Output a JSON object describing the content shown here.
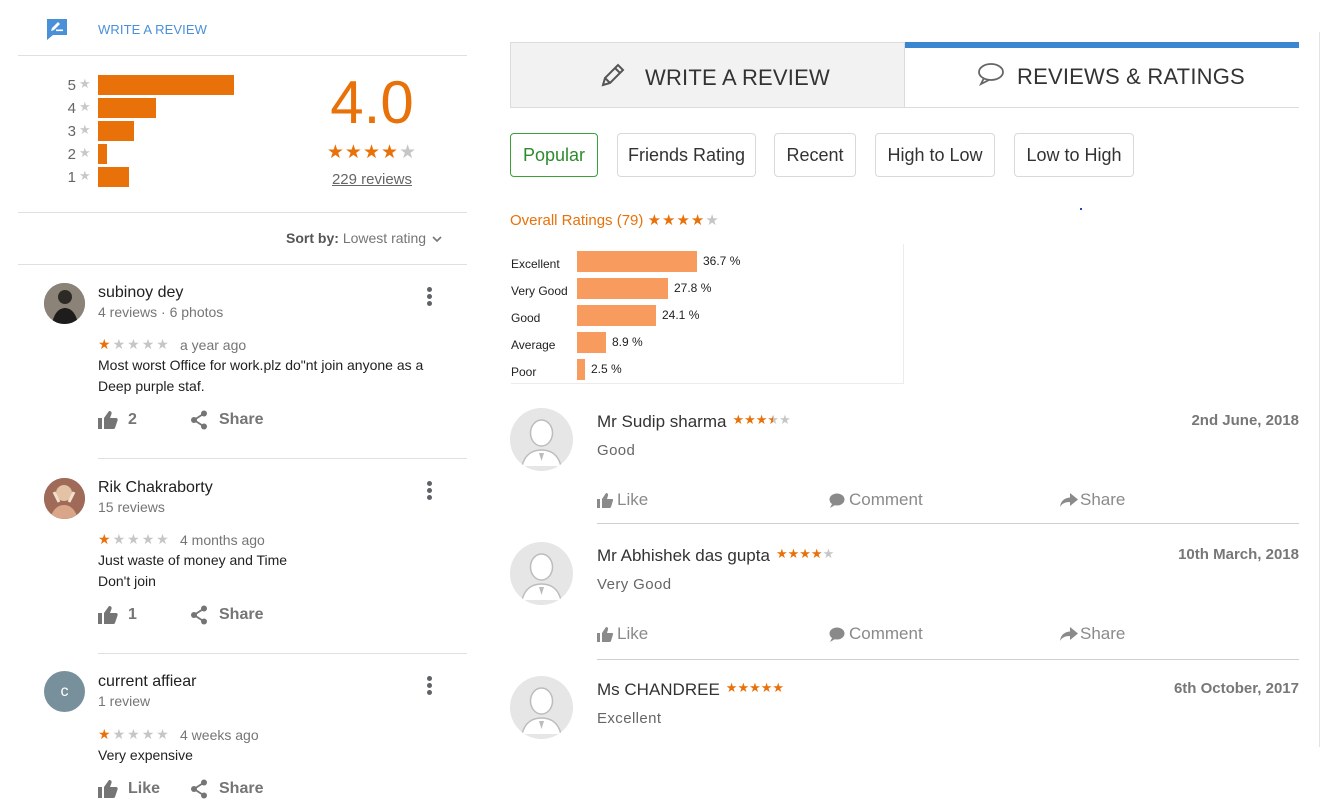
{
  "left": {
    "write_review": "WRITE A REVIEW",
    "histogram": [
      {
        "stars": "5",
        "fraction": 0.61
      },
      {
        "stars": "4",
        "fraction": 0.26
      },
      {
        "stars": "3",
        "fraction": 0.16
      },
      {
        "stars": "2",
        "fraction": 0.04
      },
      {
        "stars": "1",
        "fraction": 0.14
      }
    ],
    "score": "4.0",
    "score_stars": 4,
    "reviews_count": "229 reviews",
    "sort_label": "Sort by:",
    "sort_value": "Lowest rating",
    "reviews": [
      {
        "name": "subinoy dey",
        "meta": "4 reviews · 6 photos",
        "rating": 1,
        "time": "a year ago",
        "text": "Most worst Office for work.plz do\"nt join anyone as  a Deep purple staf.",
        "likes": "2",
        "share": "Share"
      },
      {
        "name": "Rik Chakraborty",
        "meta": "15 reviews",
        "rating": 1,
        "time": "4 months ago",
        "text": "Just waste of money and Time\nDon't join",
        "likes": "1",
        "share": "Share"
      },
      {
        "name": "current affiear",
        "meta": "1 review",
        "rating": 1,
        "time": "4 weeks ago",
        "text": "Very expensive",
        "likes": "Like",
        "share": "Share",
        "initial": "c"
      }
    ]
  },
  "right": {
    "tabs": {
      "write": "WRITE A REVIEW",
      "reviews": "REVIEWS & RATINGS"
    },
    "filters": [
      "Popular",
      "Friends Rating",
      "Recent",
      "High to Low",
      "Low to High"
    ],
    "overall_label": "Overall Ratings (79)",
    "overall_stars": 4,
    "distribution": [
      {
        "label": "Excellent",
        "pct": 36.7,
        "pct_text": "36.7 %"
      },
      {
        "label": "Very Good",
        "pct": 27.8,
        "pct_text": "27.8 %"
      },
      {
        "label": "Good",
        "pct": 24.1,
        "pct_text": "24.1 %"
      },
      {
        "label": "Average",
        "pct": 8.9,
        "pct_text": "8.9 %"
      },
      {
        "label": "Poor",
        "pct": 2.5,
        "pct_text": "2.5 %"
      }
    ],
    "reviews": [
      {
        "name": "Mr Sudip sharma",
        "rating": 3.5,
        "date": "2nd June, 2018",
        "text": "Good"
      },
      {
        "name": "Mr Abhishek das gupta",
        "rating": 4,
        "date": "10th March, 2018",
        "text": "Very Good"
      },
      {
        "name": "Ms CHANDREE",
        "rating": 5,
        "date": "6th October, 2017",
        "text": "Excellent"
      }
    ],
    "actions": {
      "like": "Like",
      "comment": "Comment",
      "share": "Share"
    }
  },
  "colors": {
    "orange": "#e8710a",
    "jd_bar": "#f89b5f",
    "tab_blue": "#3a87cf",
    "link_blue": "#4a90d9",
    "pill_green": "#2e8b2e"
  },
  "icons": [
    "edit-icon",
    "star-icon",
    "kebab-menu-icon",
    "thumbs-up-icon",
    "share-icon",
    "pencil-icon",
    "chat-bubble-icon",
    "comment-icon",
    "share-arrow-icon",
    "chevron-down-icon"
  ]
}
